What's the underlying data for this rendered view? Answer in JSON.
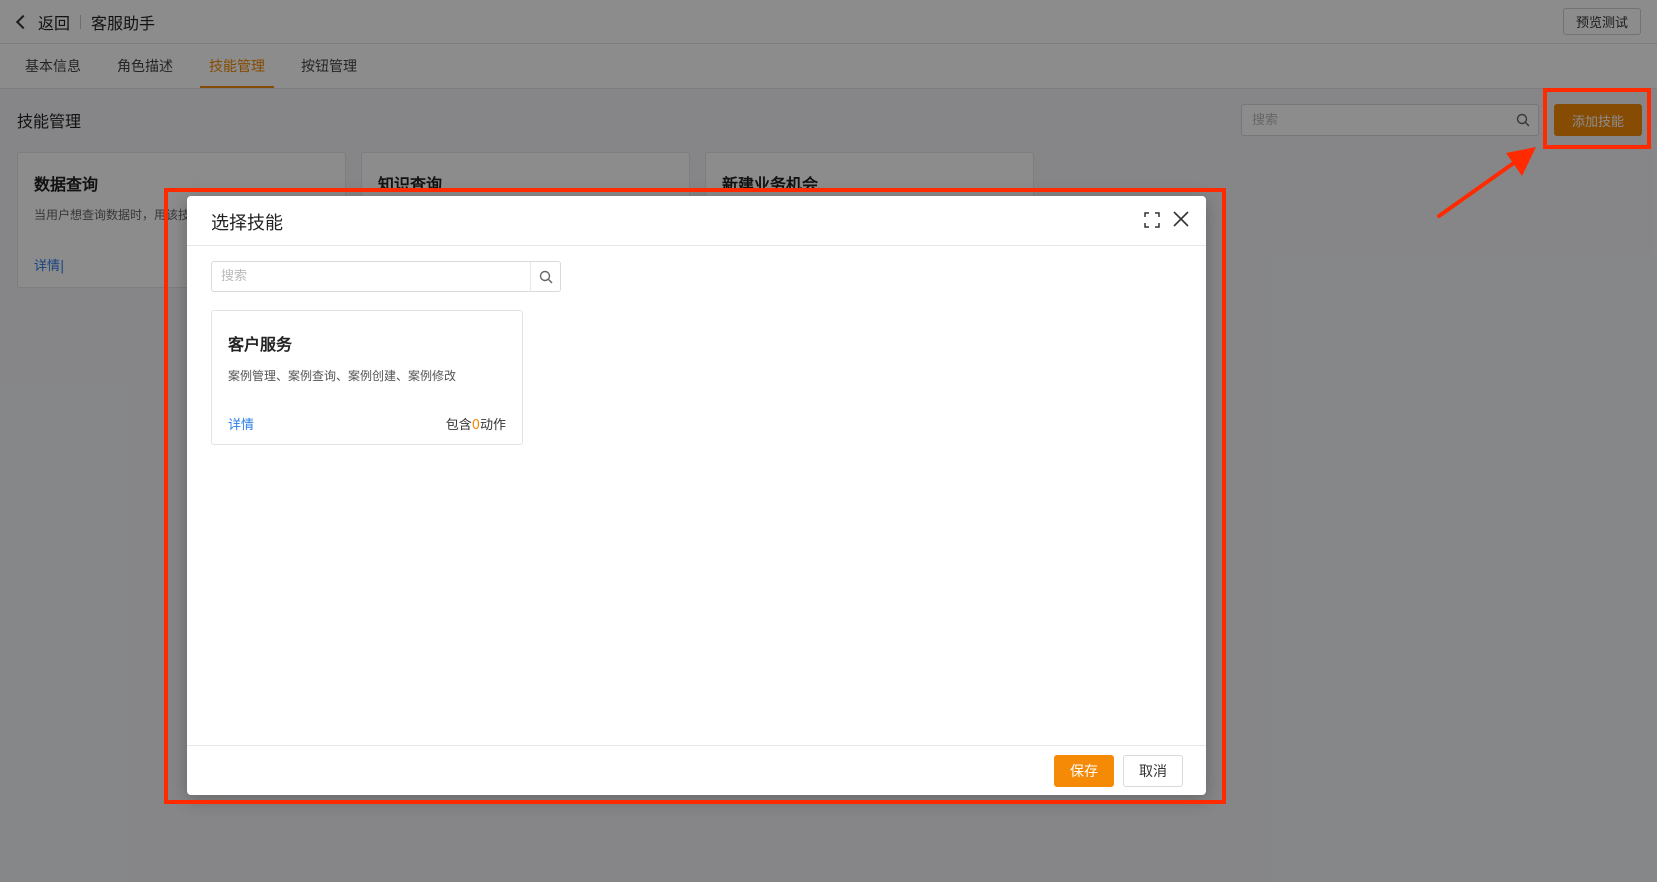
{
  "header": {
    "back_label": "返回",
    "title": "客服助手",
    "preview_label": "预览测试"
  },
  "tabs": [
    {
      "label": "基本信息",
      "active": false
    },
    {
      "label": "角色描述",
      "active": false
    },
    {
      "label": "技能管理",
      "active": true
    },
    {
      "label": "按钮管理",
      "active": false
    }
  ],
  "main": {
    "section_title": "技能管理",
    "search_placeholder": "搜索",
    "add_skill_label": "添加技能",
    "cards": [
      {
        "title": "数据查询",
        "desc": "当用户想查询数据时，用该技",
        "link": "详情|"
      },
      {
        "title": "知识查询",
        "desc": "",
        "link": ""
      },
      {
        "title": "新建业务机会",
        "desc": "",
        "link": ""
      }
    ]
  },
  "modal": {
    "title": "选择技能",
    "search_placeholder": "搜索",
    "skill": {
      "title": "客户服务",
      "desc": "案例管理、案例查询、案例创建、案例修改",
      "link": "详情",
      "count_prefix": "包含",
      "count_value": "0",
      "count_suffix": "动作"
    },
    "save_label": "保存",
    "cancel_label": "取消"
  },
  "colors": {
    "accent": "#f58a07",
    "link": "#2b7de9",
    "annotation": "#ff2a00"
  },
  "icons": [
    "chevron-left-icon",
    "search-icon",
    "expand-icon",
    "close-icon",
    "arrow-annotation"
  ]
}
